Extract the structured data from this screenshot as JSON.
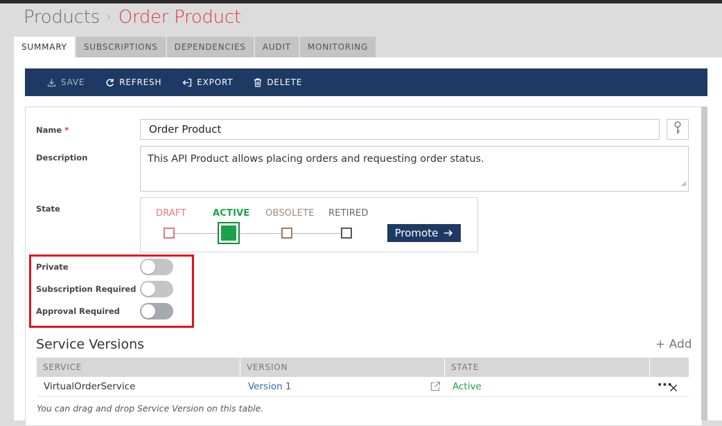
{
  "breadcrumb": {
    "root": "Products",
    "separator": "›",
    "current": "Order Product"
  },
  "tabs": [
    "SUMMARY",
    "SUBSCRIPTIONS",
    "DEPENDENCIES",
    "AUDIT",
    "MONITORING"
  ],
  "active_tab": "SUMMARY",
  "toolbar": {
    "save": "SAVE",
    "refresh": "REFRESH",
    "export": "EXPORT",
    "delete": "DELETE"
  },
  "form": {
    "name_label": "Name",
    "required_marker": "*",
    "name_value": "Order Product",
    "description_label": "Description",
    "description_value": "This API Product allows placing orders and requesting order status.",
    "state_label": "State",
    "states": [
      "DRAFT",
      "ACTIVE",
      "OBSOLETE",
      "RETIRED"
    ],
    "current_state": "ACTIVE",
    "promote_label": "Promote",
    "private_label": "Private",
    "subscription_required_label": "Subscription Required",
    "approval_required_label": "Approval Required",
    "private": false,
    "subscription_required": false,
    "approval_required": false
  },
  "service_versions": {
    "title": "Service Versions",
    "add_label": "+ Add",
    "columns": [
      "SERVICE",
      "VERSION",
      "STATE"
    ],
    "rows": [
      {
        "service": "VirtualOrderService",
        "version": "Version 1",
        "state": "Active"
      }
    ],
    "hint": "You can drag and drop Service Version on this table."
  },
  "colors": {
    "accent_red": "#e0393b",
    "navy": "#1e3a64",
    "active_green": "#1aa34a",
    "highlight_red": "#e2121e",
    "link_blue": "#2a6ab0"
  },
  "icons": [
    "save-icon",
    "refresh-icon",
    "export-icon",
    "delete-icon",
    "key-icon",
    "arrow-right-icon",
    "external-link-icon",
    "more-icon",
    "close-icon"
  ]
}
